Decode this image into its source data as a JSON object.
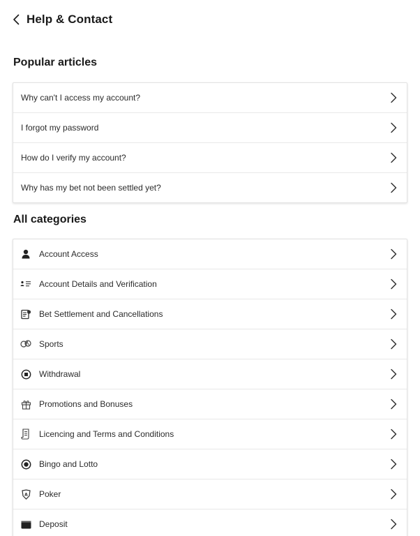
{
  "header": {
    "title": "Help & Contact",
    "back_icon": "chevron-left-icon"
  },
  "popular": {
    "title": "Popular articles",
    "items": [
      {
        "label": "Why can't I access my account?"
      },
      {
        "label": "I forgot my password"
      },
      {
        "label": "How do I verify my account?"
      },
      {
        "label": "Why has my bet not been settled yet?"
      }
    ]
  },
  "categories": {
    "title": "All categories",
    "items": [
      {
        "label": "Account Access",
        "icon": "person-icon"
      },
      {
        "label": "Account Details and Verification",
        "icon": "id-card-icon"
      },
      {
        "label": "Bet Settlement and Cancellations",
        "icon": "bet-slip-icon"
      },
      {
        "label": "Sports",
        "icon": "sports-balls-icon"
      },
      {
        "label": "Withdrawal",
        "icon": "withdrawal-icon"
      },
      {
        "label": "Promotions and Bonuses",
        "icon": "gift-icon"
      },
      {
        "label": "Licencing and Terms and Conditions",
        "icon": "document-scroll-icon"
      },
      {
        "label": "Bingo and Lotto",
        "icon": "bingo-ball-icon"
      },
      {
        "label": "Poker",
        "icon": "poker-shield-icon"
      },
      {
        "label": "Deposit",
        "icon": "wallet-icon"
      }
    ]
  }
}
